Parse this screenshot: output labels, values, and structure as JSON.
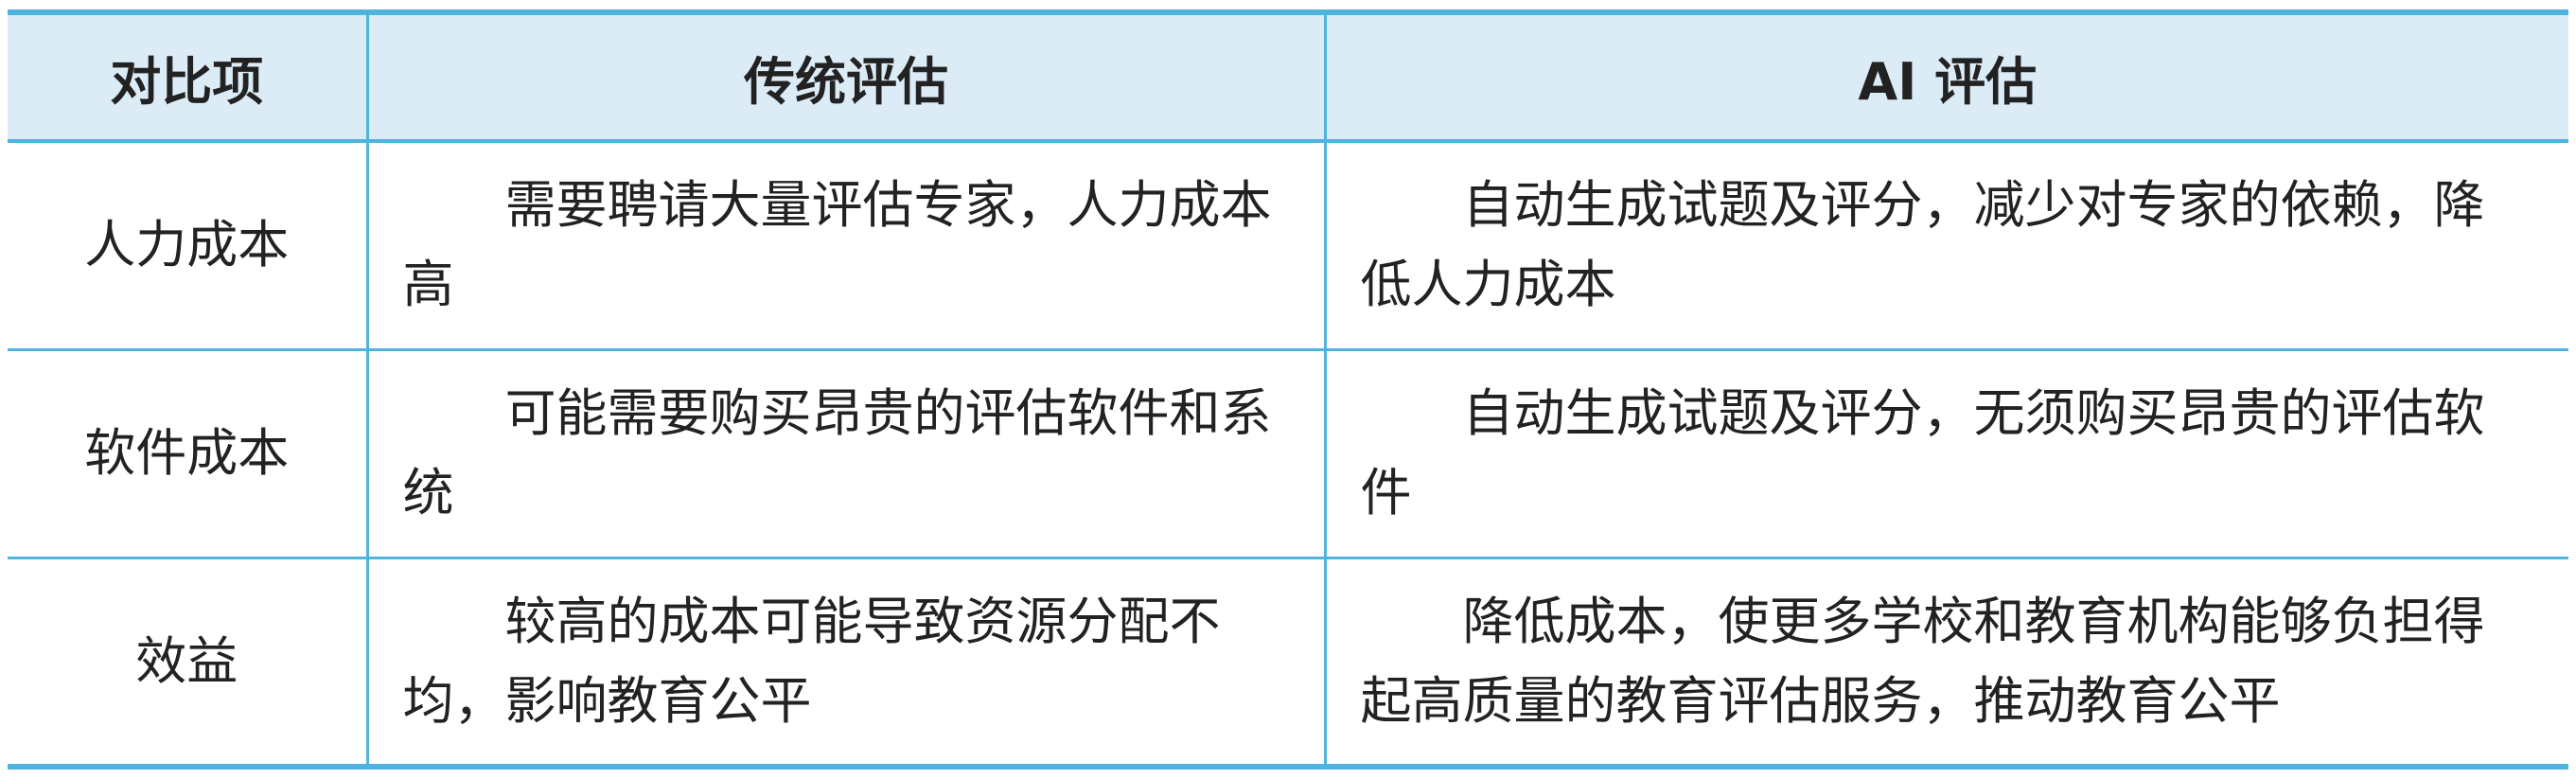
{
  "table": {
    "headers": [
      "对比项",
      "传统评估",
      "AI 评估"
    ],
    "rows": [
      {
        "item": "人力成本",
        "traditional": "需要聘请大量评估专家，人力成本高",
        "ai": "自动生成试题及评分，减少对专家的依赖，降低人力成本"
      },
      {
        "item": "软件成本",
        "traditional": "可能需要购买昂贵的评估软件和系统",
        "ai": "自动生成试题及评分，无须购买昂贵的评估软件"
      },
      {
        "item": "效益",
        "traditional": "较高的成本可能导致资源分配不均，影响教育公平",
        "ai": "降低成本，使更多学校和教育机构能够负担得起高质量的教育评估服务，推动教育公平"
      }
    ]
  },
  "colors": {
    "rule": "#4fb3dd",
    "header_bg": "#dcecf7",
    "text": "#222222"
  }
}
